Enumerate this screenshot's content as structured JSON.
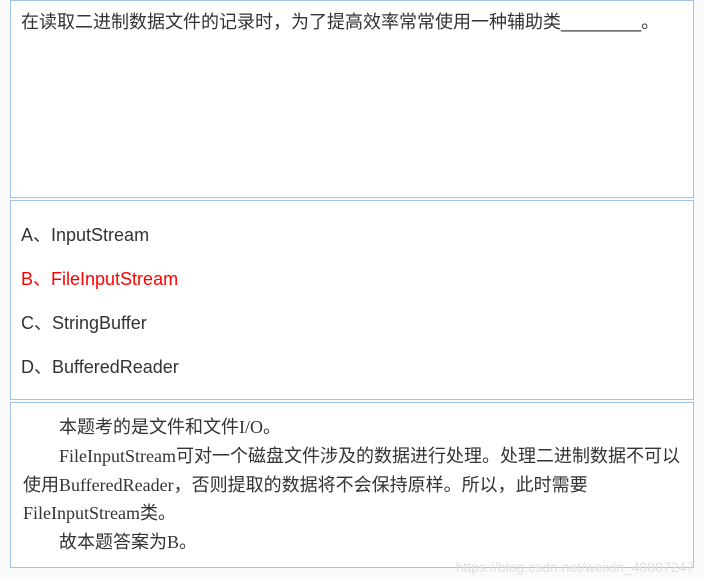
{
  "question": {
    "text": "在读取二进制数据文件的记录时，为了提高效率常常使用一种辅助类________。"
  },
  "options": [
    {
      "label": "A、",
      "text": "InputStream",
      "correct": false
    },
    {
      "label": "B、",
      "text": "FileInputStream",
      "correct": true
    },
    {
      "label": "C、",
      "text": "StringBuffer",
      "correct": false
    },
    {
      "label": "D、",
      "text": "BufferedReader",
      "correct": false
    }
  ],
  "explanation": {
    "line1": "本题考的是文件和文件I/O。",
    "line2": "FileInputStream可对一个磁盘文件涉及的数据进行处理。处理二进制数据不可以使用BufferedReader，否则提取的数据将不会保持原样。所以，此时需要FileInputStream类。",
    "line3": "故本题答案为B。"
  },
  "watermark": "https://blog.csdn.net/weixin_40807247"
}
